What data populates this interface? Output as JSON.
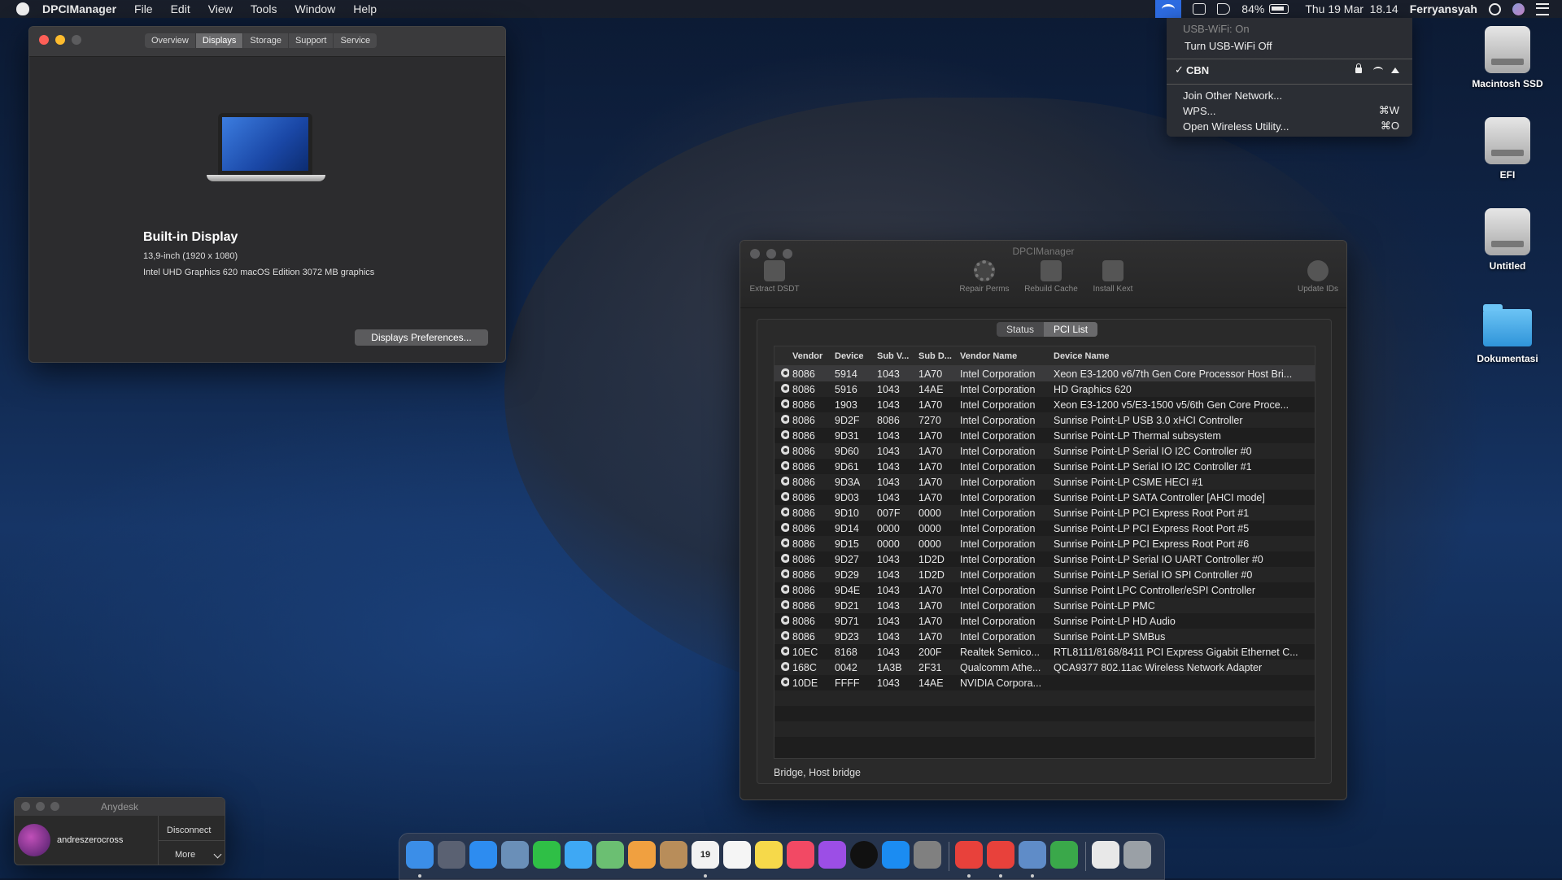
{
  "menubar": {
    "app_name": "DPCIManager",
    "items": [
      "File",
      "Edit",
      "View",
      "Tools",
      "Window",
      "Help"
    ],
    "battery": "84%",
    "datetime": "Thu 19 Mar  18.14",
    "user": "Ferryansyah"
  },
  "wifi_menu": {
    "status": "USB-WiFi: On",
    "toggle": "Turn USB-WiFi Off",
    "network": "CBN",
    "join_other": "Join Other Network...",
    "wps": "WPS...",
    "wps_shortcut": "⌘W",
    "open_utility": "Open Wireless Utility...",
    "open_utility_shortcut": "⌘O"
  },
  "desktop": {
    "icons": [
      "Macintosh SSD",
      "EFI",
      "Untitled",
      "Dokumentasi"
    ]
  },
  "about_window": {
    "tabs": [
      "Overview",
      "Displays",
      "Storage",
      "Support",
      "Service"
    ],
    "active_tab": "Displays",
    "display_name": "Built-in Display",
    "display_size": "13,9-inch (1920 x 1080)",
    "graphics": "Intel UHD Graphics 620 macOS Edition 3072 MB graphics",
    "prefs_button": "Displays Preferences..."
  },
  "dpci_window": {
    "title": "DPCIManager",
    "toolbar": {
      "extract": "Extract DSDT",
      "repair": "Repair Perms",
      "rebuild": "Rebuild Cache",
      "install": "Install Kext",
      "update": "Update IDs"
    },
    "tabs": [
      "Status",
      "PCI List"
    ],
    "active_tab": "PCI List",
    "columns": [
      "Vendor",
      "Device",
      "Sub V...",
      "Sub D...",
      "Vendor Name",
      "Device Name"
    ],
    "rows": [
      [
        "8086",
        "5914",
        "1043",
        "1A70",
        "Intel Corporation",
        "Xeon E3-1200 v6/7th Gen Core Processor Host Bri..."
      ],
      [
        "8086",
        "5916",
        "1043",
        "14AE",
        "Intel Corporation",
        "HD Graphics 620"
      ],
      [
        "8086",
        "1903",
        "1043",
        "1A70",
        "Intel Corporation",
        "Xeon E3-1200 v5/E3-1500 v5/6th Gen Core Proce..."
      ],
      [
        "8086",
        "9D2F",
        "8086",
        "7270",
        "Intel Corporation",
        "Sunrise Point-LP USB 3.0 xHCI Controller"
      ],
      [
        "8086",
        "9D31",
        "1043",
        "1A70",
        "Intel Corporation",
        "Sunrise Point-LP Thermal subsystem"
      ],
      [
        "8086",
        "9D60",
        "1043",
        "1A70",
        "Intel Corporation",
        "Sunrise Point-LP Serial IO I2C Controller #0"
      ],
      [
        "8086",
        "9D61",
        "1043",
        "1A70",
        "Intel Corporation",
        "Sunrise Point-LP Serial IO I2C Controller #1"
      ],
      [
        "8086",
        "9D3A",
        "1043",
        "1A70",
        "Intel Corporation",
        "Sunrise Point-LP CSME HECI #1"
      ],
      [
        "8086",
        "9D03",
        "1043",
        "1A70",
        "Intel Corporation",
        "Sunrise Point-LP SATA Controller [AHCI mode]"
      ],
      [
        "8086",
        "9D10",
        "007F",
        "0000",
        "Intel Corporation",
        "Sunrise Point-LP PCI Express Root Port #1"
      ],
      [
        "8086",
        "9D14",
        "0000",
        "0000",
        "Intel Corporation",
        "Sunrise Point-LP PCI Express Root Port #5"
      ],
      [
        "8086",
        "9D15",
        "0000",
        "0000",
        "Intel Corporation",
        "Sunrise Point-LP PCI Express Root Port #6"
      ],
      [
        "8086",
        "9D27",
        "1043",
        "1D2D",
        "Intel Corporation",
        "Sunrise Point-LP Serial IO UART Controller #0"
      ],
      [
        "8086",
        "9D29",
        "1043",
        "1D2D",
        "Intel Corporation",
        "Sunrise Point-LP Serial IO SPI Controller #0"
      ],
      [
        "8086",
        "9D4E",
        "1043",
        "1A70",
        "Intel Corporation",
        "Sunrise Point LPC Controller/eSPI Controller"
      ],
      [
        "8086",
        "9D21",
        "1043",
        "1A70",
        "Intel Corporation",
        "Sunrise Point-LP PMC"
      ],
      [
        "8086",
        "9D71",
        "1043",
        "1A70",
        "Intel Corporation",
        "Sunrise Point-LP HD Audio"
      ],
      [
        "8086",
        "9D23",
        "1043",
        "1A70",
        "Intel Corporation",
        "Sunrise Point-LP SMBus"
      ],
      [
        "10EC",
        "8168",
        "1043",
        "200F",
        "Realtek Semico...",
        "RTL8111/8168/8411 PCI Express Gigabit Ethernet C..."
      ],
      [
        "168C",
        "0042",
        "1A3B",
        "2F31",
        "Qualcomm Athe...",
        "QCA9377 802.11ac Wireless Network Adapter"
      ],
      [
        "10DE",
        "FFFF",
        "1043",
        "14AE",
        "NVIDIA Corpora...",
        ""
      ]
    ],
    "status_text": "Bridge, Host bridge"
  },
  "anydesk": {
    "title": "Anydesk",
    "user": "andreszerocross",
    "disconnect": "Disconnect",
    "more": "More"
  },
  "dock": {
    "calendar_day": "19",
    "colors": {
      "finder": "#3b8ee8",
      "launchpad": "#5a6172",
      "safari": "#2d8cf0",
      "preview": "#6a8fb8",
      "facetime": "#2fbf46",
      "messages": "#3ea8f4",
      "maps": "#6bbf72",
      "photos": "#f0a040",
      "contacts": "#b88d5a",
      "calendar": "#f2f2f2",
      "reminders": "#f5f5f5",
      "notes": "#f6d94a",
      "music": "#f24964",
      "podcasts": "#9c4ee6",
      "tv": "#111111",
      "appstore": "#1b8cf2",
      "preferences": "#808080",
      "anydesk1": "#e8413b",
      "anydesk2": "#e8413b",
      "kext": "#5f8cc8",
      "network": "#3aa84a",
      "file": "#e8e8e8",
      "trash": "#9aa0a6"
    }
  }
}
